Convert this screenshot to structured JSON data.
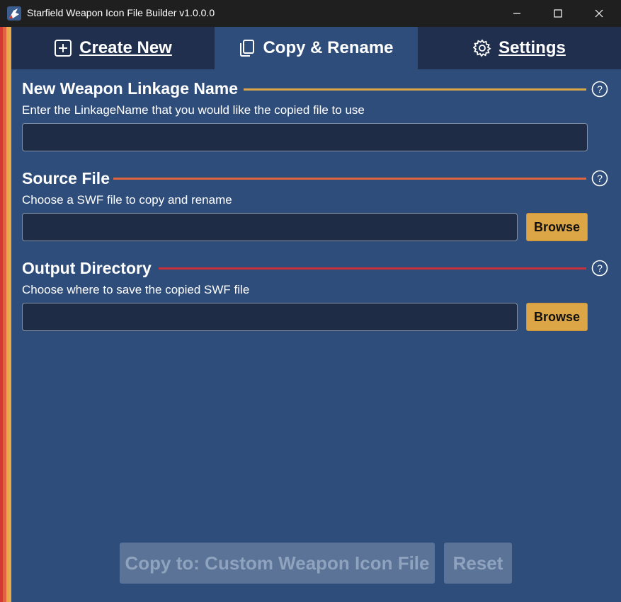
{
  "window": {
    "title": "Starfield Weapon Icon File Builder v1.0.0.0",
    "icons": {
      "app": "app-logo-icon",
      "minimize": "minimize-icon",
      "maximize": "maximize-icon",
      "close": "close-icon"
    }
  },
  "tabs": [
    {
      "label": "Create New",
      "icon": "plus-square-icon",
      "active": false
    },
    {
      "label": "Copy & Rename",
      "icon": "copy-icon",
      "active": true
    },
    {
      "label": "Settings",
      "icon": "gear-icon",
      "active": false
    }
  ],
  "sections": {
    "linkage": {
      "title": "New Weapon Linkage Name",
      "description": "Enter the LinkageName that you would like the copied file to use",
      "value": ""
    },
    "source": {
      "title": "Source File",
      "description": "Choose a SWF file to copy and rename",
      "value": "",
      "browse_label": "Browse"
    },
    "output": {
      "title": "Output Directory",
      "description": "Choose where to save the copied SWF file",
      "value": "",
      "browse_label": "Browse"
    }
  },
  "actions": {
    "copy_label": "Copy to: Custom Weapon Icon File",
    "reset_label": "Reset"
  },
  "colors": {
    "background": "#2f4d7a",
    "tab_bar": "#1f2f4d",
    "line_linkage": "#d9a64a",
    "line_source": "#e0653e",
    "line_output": "#c8303a",
    "browse": "#dca646"
  }
}
